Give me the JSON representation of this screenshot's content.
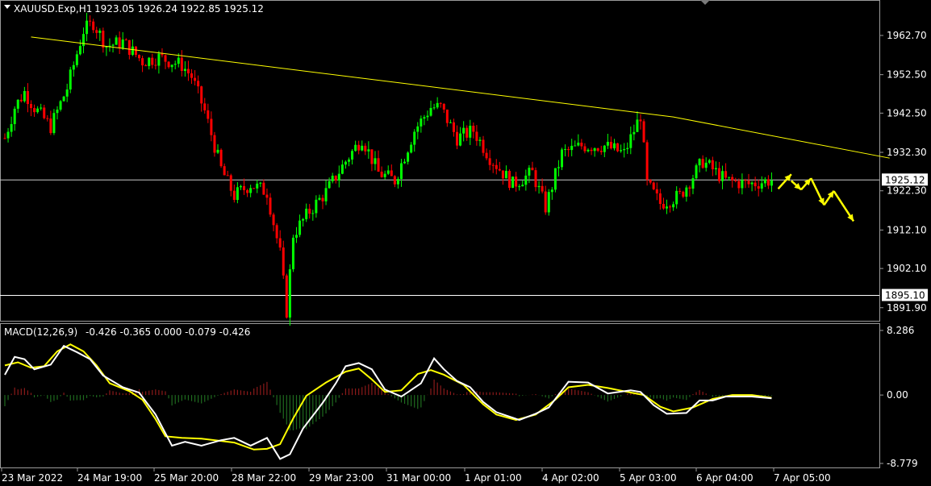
{
  "header": {
    "symbol": "XAUUSD.Exp,H1",
    "ohlc": "1923.05 1926.24 1922.85 1925.12"
  },
  "colors": {
    "background": "#000000",
    "bull": "#00ff00",
    "bear": "#ff0000",
    "trendline": "#ffff00",
    "hline": "#c8c8c8",
    "arrow": "#ffff00",
    "macd_main": "#ffffff",
    "macd_signal": "#ffff00",
    "hist_up": "#8b1a1a",
    "hist_down": "#1f6b1f",
    "price_label_bg": "#ffffff",
    "price_label_text": "#000000"
  },
  "chart_data": [
    {
      "type": "candlestick",
      "title": "XAUUSD.Exp,H1",
      "ylim": [
        1888.5,
        1971.5
      ],
      "y_ticks": [
        "1962.70",
        "1952.50",
        "1942.50",
        "1932.30",
        "1922.30",
        "1912.10",
        "1902.10",
        "1891.90"
      ],
      "y_tick_values": [
        1962.7,
        1952.5,
        1942.5,
        1932.3,
        1922.3,
        1912.1,
        1902.1,
        1891.9
      ],
      "x_ticks": [
        "23 Mar 2022",
        "24 Mar 19:00",
        "25 Mar 20:00",
        "28 Mar 22:00",
        "29 Mar 23:00",
        "31 Mar 00:00",
        "1 Apr 01:00",
        "4 Apr 02:00",
        "5 Apr 03:00",
        "6 Apr 04:00",
        "7 Apr 05:00"
      ],
      "bar_count": 200,
      "close_path": [
        [
          0,
          1936
        ],
        [
          3,
          1944
        ],
        [
          6,
          1948
        ],
        [
          9,
          1944
        ],
        [
          14,
          1939
        ],
        [
          19,
          1949
        ],
        [
          24,
          1964
        ],
        [
          27,
          1966
        ],
        [
          31,
          1960
        ],
        [
          36,
          1961
        ],
        [
          42,
          1956
        ],
        [
          47,
          1957
        ],
        [
          54,
          1955
        ],
        [
          57,
          1952
        ],
        [
          61,
          1943
        ],
        [
          66,
          1928
        ],
        [
          70,
          1921
        ],
        [
          75,
          1924
        ],
        [
          80,
          1922
        ],
        [
          84,
          1906
        ],
        [
          86,
          1891
        ],
        [
          88,
          1911
        ],
        [
          93,
          1917
        ],
        [
          98,
          1922
        ],
        [
          104,
          1930
        ],
        [
          109,
          1936
        ],
        [
          114,
          1927
        ],
        [
          119,
          1925
        ],
        [
          125,
          1938
        ],
        [
          130,
          1944
        ],
        [
          133,
          1944
        ],
        [
          138,
          1936
        ],
        [
          143,
          1938
        ],
        [
          148,
          1931
        ],
        [
          155,
          1924
        ],
        [
          161,
          1927
        ],
        [
          165,
          1918
        ],
        [
          170,
          1932
        ],
        [
          176,
          1934
        ],
        [
          183,
          1934
        ],
        [
          189,
          1932
        ],
        [
          194,
          1942
        ],
        [
          196,
          1924
        ],
        [
          200,
          1919
        ],
        [
          206,
          1921
        ],
        [
          213,
          1930
        ],
        [
          220,
          1925
        ],
        [
          227,
          1924
        ],
        [
          234,
          1925.12
        ]
      ],
      "current_price": "1925.12",
      "current_price_value": 1925.12,
      "support_level": "1895.10",
      "support_level_value": 1895.1,
      "trendline": [
        [
          1962.3,
          8
        ],
        [
          1941.5,
          204
        ],
        [
          1930.8,
          270
        ]
      ],
      "projection_arrows": [
        [
          [
            236,
            1922.8
          ],
          [
            240,
            1926.6
          ]
        ],
        [
          [
            240,
            1924.9
          ],
          [
            243,
            1922.6
          ]
        ],
        [
          [
            243,
            1922.6
          ],
          [
            246,
            1925.5
          ]
        ],
        [
          [
            246,
            1925.6
          ],
          [
            250,
            1918.6
          ]
        ],
        [
          [
            250,
            1918.6
          ],
          [
            253,
            1922.3
          ]
        ],
        [
          [
            253,
            1922.2
          ],
          [
            259,
            1914.4
          ]
        ]
      ]
    },
    {
      "type": "line",
      "title": "MACD(12,26,9)",
      "values_text": "-0.426 -0.365 0.000 -0.079 -0.426",
      "ylim": [
        -8.779,
        8.286
      ],
      "y_ticks": [
        "8.286",
        "0.00",
        "-8.779"
      ],
      "y_tick_values": [
        8.286,
        0.0,
        -8.779
      ],
      "series": [
        {
          "name": "MACD",
          "points": [
            [
              0,
              2.6
            ],
            [
              3,
              4.9
            ],
            [
              6,
              4.6
            ],
            [
              9,
              3.3
            ],
            [
              14,
              3.9
            ],
            [
              18,
              6.3
            ],
            [
              22,
              5.5
            ],
            [
              26,
              4.6
            ],
            [
              30,
              2.5
            ],
            [
              36,
              1.0
            ],
            [
              41,
              0.3
            ],
            [
              46,
              -2.5
            ],
            [
              51,
              -6.5
            ],
            [
              55,
              -6.0
            ],
            [
              60,
              -6.5
            ],
            [
              66,
              -5.8
            ],
            [
              70,
              -5.5
            ],
            [
              75,
              -6.5
            ],
            [
              80,
              -5.5
            ],
            [
              84,
              -8.2
            ],
            [
              87,
              -7.6
            ],
            [
              91,
              -4.3
            ],
            [
              97,
              -1.0
            ],
            [
              101,
              1.5
            ],
            [
              104,
              3.7
            ],
            [
              108,
              4.1
            ],
            [
              112,
              3.3
            ],
            [
              116,
              0.7
            ],
            [
              121,
              -0.2
            ],
            [
              127,
              1.5
            ],
            [
              131,
              4.7
            ],
            [
              134,
              3.3
            ],
            [
              138,
              1.8
            ],
            [
              142,
              1.0
            ],
            [
              146,
              -0.9
            ],
            [
              150,
              -2.2
            ],
            [
              157,
              -3.2
            ],
            [
              162,
              -2.4
            ],
            [
              166,
              -1.6
            ],
            [
              172,
              1.7
            ],
            [
              178,
              1.6
            ],
            [
              184,
              0.2
            ],
            [
              191,
              0.6
            ],
            [
              194,
              0.4
            ],
            [
              198,
              -1.3
            ],
            [
              202,
              -2.4
            ],
            [
              208,
              -2.3
            ],
            [
              212,
              -0.7
            ],
            [
              216,
              -0.7
            ],
            [
              220,
              -0.2
            ],
            [
              228,
              -0.2
            ],
            [
              234,
              -0.426
            ]
          ]
        },
        {
          "name": "Signal",
          "points": [
            [
              0,
              3.8
            ],
            [
              4,
              4.2
            ],
            [
              8,
              3.5
            ],
            [
              12,
              3.7
            ],
            [
              16,
              5.6
            ],
            [
              20,
              6.5
            ],
            [
              24,
              5.6
            ],
            [
              28,
              3.8
            ],
            [
              32,
              1.5
            ],
            [
              38,
              0.5
            ],
            [
              42,
              -0.6
            ],
            [
              46,
              -3.1
            ],
            [
              49,
              -5.3
            ],
            [
              54,
              -5.5
            ],
            [
              60,
              -5.6
            ],
            [
              66,
              -5.9
            ],
            [
              70,
              -6.1
            ],
            [
              76,
              -7.0
            ],
            [
              80,
              -6.9
            ],
            [
              84,
              -6.3
            ],
            [
              88,
              -3.0
            ],
            [
              92,
              -0.1
            ],
            [
              98,
              1.6
            ],
            [
              104,
              3.0
            ],
            [
              108,
              3.4
            ],
            [
              112,
              2.0
            ],
            [
              116,
              0.4
            ],
            [
              121,
              0.6
            ],
            [
              126,
              2.7
            ],
            [
              130,
              3.2
            ],
            [
              134,
              2.6
            ],
            [
              140,
              1.3
            ],
            [
              146,
              -1.2
            ],
            [
              150,
              -2.5
            ],
            [
              156,
              -3.2
            ],
            [
              162,
              -2.5
            ],
            [
              168,
              -0.6
            ],
            [
              172,
              1.0
            ],
            [
              178,
              1.3
            ],
            [
              184,
              0.9
            ],
            [
              190,
              0.4
            ],
            [
              195,
              0.0
            ],
            [
              200,
              -1.5
            ],
            [
              204,
              -2.1
            ],
            [
              210,
              -1.6
            ],
            [
              216,
              -0.5
            ],
            [
              222,
              0.0
            ],
            [
              228,
              0.0
            ],
            [
              234,
              -0.365
            ]
          ]
        }
      ]
    }
  ]
}
